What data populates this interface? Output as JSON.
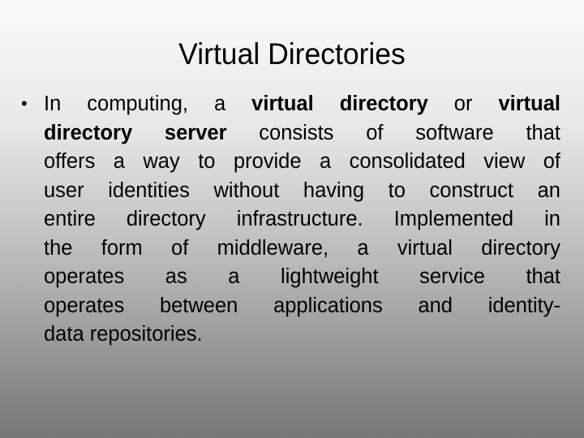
{
  "slide": {
    "title": "Virtual Directories",
    "bullet_glyph": "•",
    "paragraph": {
      "lines": [
        [
          {
            "text": "In computing, a ",
            "bold": false
          },
          {
            "text": "virtual directory",
            "bold": true
          },
          {
            "text": " or ",
            "bold": false
          },
          {
            "text": "virtual",
            "bold": true
          }
        ],
        [
          {
            "text": "directory server",
            "bold": true
          },
          {
            "text": " consists of software that",
            "bold": false
          }
        ],
        [
          {
            "text": "offers a way to provide a consolidated view of",
            "bold": false
          }
        ],
        [
          {
            "text": "user identities without having to construct an",
            "bold": false
          }
        ],
        [
          {
            "text": "entire directory infrastructure. Implemented in",
            "bold": false
          }
        ],
        [
          {
            "text": "the form of middleware, a virtual directory",
            "bold": false
          }
        ],
        [
          {
            "text": "operates as a lightweight service that",
            "bold": false
          }
        ],
        [
          {
            "text": "operates between applications and identity-",
            "bold": false
          }
        ],
        [
          {
            "text": "data repositories.",
            "bold": false
          }
        ]
      ]
    },
    "colors": {
      "text": "#000000",
      "background_top": "#fbfbfb",
      "background_bottom": "#777777"
    }
  }
}
